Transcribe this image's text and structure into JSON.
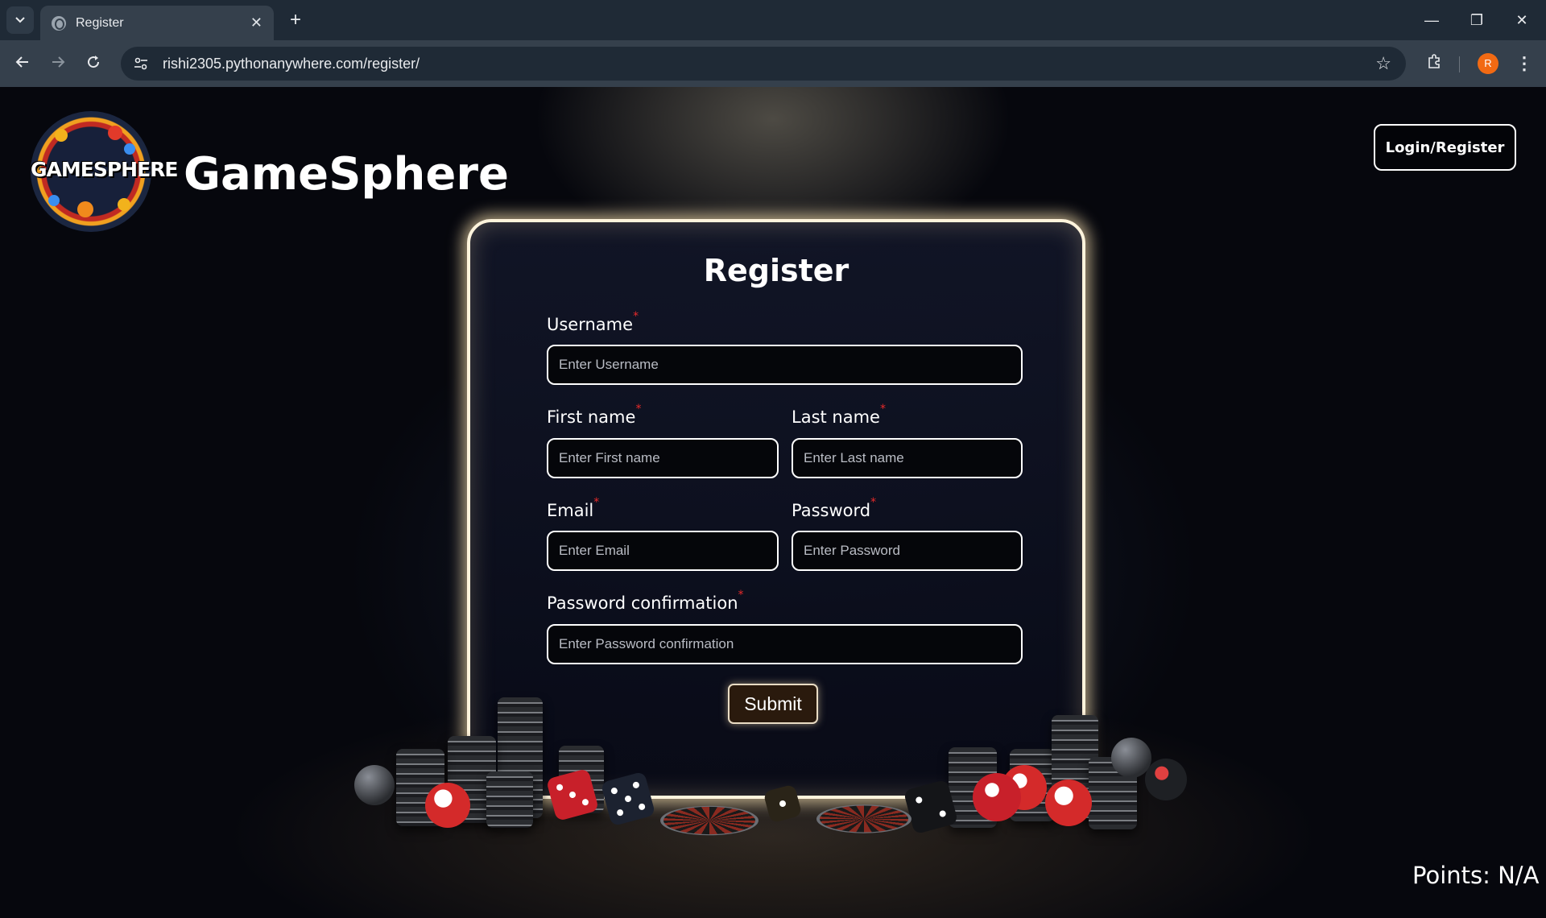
{
  "browser": {
    "tab_title": "Register",
    "tab_close": "✕",
    "new_tab": "+",
    "url": "rishi2305.pythonanywhere.com/register/",
    "profile_initial": "R"
  },
  "header": {
    "logo_text": "GAMESPHERE",
    "site_title": "GameSphere",
    "login_button": "Login/Register"
  },
  "form": {
    "title": "Register",
    "required_marker": "*",
    "fields": {
      "username": {
        "label": "Username",
        "placeholder": "Enter Username",
        "value": ""
      },
      "first_name": {
        "label": "First name",
        "placeholder": "Enter First name",
        "value": ""
      },
      "last_name": {
        "label": "Last name",
        "placeholder": "Enter Last name",
        "value": ""
      },
      "email": {
        "label": "Email",
        "placeholder": "Enter Email",
        "value": ""
      },
      "password": {
        "label": "Password",
        "placeholder": "Enter Password",
        "value": ""
      },
      "password_confirmation": {
        "label": "Password confirmation",
        "placeholder": "Enter Password confirmation",
        "value": ""
      }
    },
    "submit_label": "Submit"
  },
  "status": {
    "points": "Points: N/A"
  },
  "icons": {
    "tab_menu": "chevron-down-icon",
    "favicon": "globe-icon",
    "back": "arrow-left-icon",
    "forward": "arrow-right-icon",
    "reload": "reload-icon",
    "site_info": "tune-icon",
    "bookmark": "star-icon",
    "extensions": "puzzle-icon",
    "menu": "more-vert-icon"
  },
  "colors": {
    "card_glow": "#fff4dc",
    "required": "#e82a2a",
    "submit_bg": "#2a1a0d",
    "avatar": "#f26a13"
  }
}
